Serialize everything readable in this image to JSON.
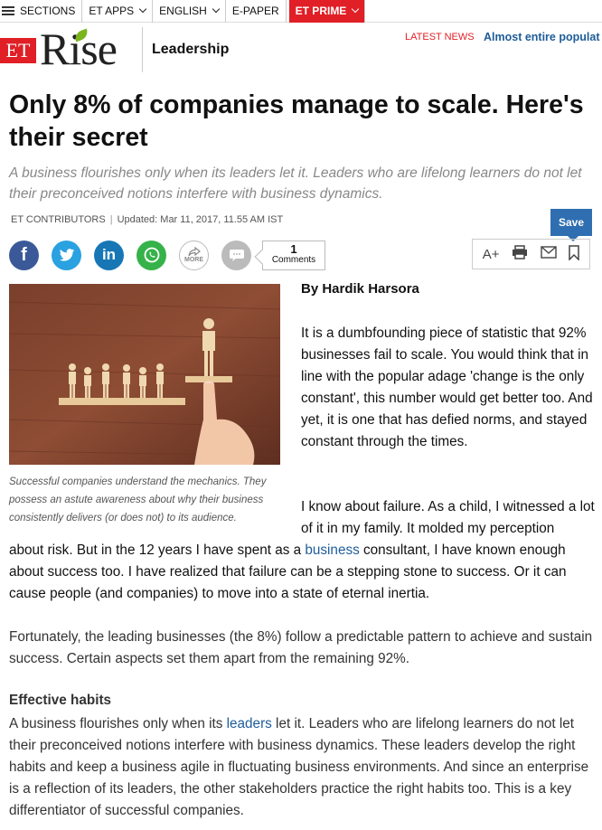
{
  "topnav": {
    "sections": "SECTIONS",
    "et_apps": "ET APPS",
    "english": "ENGLISH",
    "epaper": "E-PAPER",
    "et_prime": "ET PRIME"
  },
  "brand": {
    "et": "ET",
    "rise": "Rise",
    "section": "Leadership",
    "latest_news_label": "LATEST NEWS",
    "latest_news_text": "Almost entire populat"
  },
  "article": {
    "title": "Only 8% of companies manage to scale. Here's their secret",
    "synopsis": "A business flourishes only when its leaders let it. Leaders who are lifelong learners do not let their preconceived notions interfere with business dynamics.",
    "author_credit": "ET CONTRIBUTORS",
    "updated": "Updated: Mar 11, 2017, 11.55 AM IST",
    "byline": "By Hardik Harsora",
    "image_caption": "Successful companies understand the mechanics. They possess an astute awareness about why their business consistently delivers (or does not) to its audience.",
    "p1": "It is a dumbfounding piece of statistic that 92% businesses fail to scale. You would think that in line with the popular adage 'change is the only constant', this number would get better too. And yet, it is one that has defied norms, and stayed constant through the times.",
    "p2_start": "I know about failure. As a child, I witnessed a lot of it in my family. It molded my perception",
    "p2_before_link": "about risk. But in the 12 years I have spent as a ",
    "p2_link": "business",
    "p2_after_link": " consultant, I have known enough about success too. I have realized that failure can be a stepping stone to success. Or it can cause people (and companies) to move into a state of eternal inertia.",
    "p3": "Fortunately, the leading businesses (the 8%) follow a predictable pattern to achieve and sustain success. Certain aspects set them apart from the remaining 92%.",
    "h_effective": "Effective habits",
    "p4_before_link": "A business flourishes only when its ",
    "p4_link": "leaders",
    "p4_after_link": " let it. Leaders who are lifelong learners do not let their preconceived notions interfere with business dynamics. These leaders develop the right habits and keep a business agile in fluctuating business environments. And since an enterprise is a reflection of its leaders, the other stakeholders practice the right habits too. This is a key differentiator of successful companies."
  },
  "share": {
    "more_label": "MORE",
    "comments_count": "1",
    "comments_label": "Comments"
  },
  "tools": {
    "save": "Save",
    "font_size": "A+"
  },
  "colors": {
    "accent_red": "#e01f26",
    "link_blue": "#1e5d99",
    "save_blue": "#2f6fb1"
  }
}
